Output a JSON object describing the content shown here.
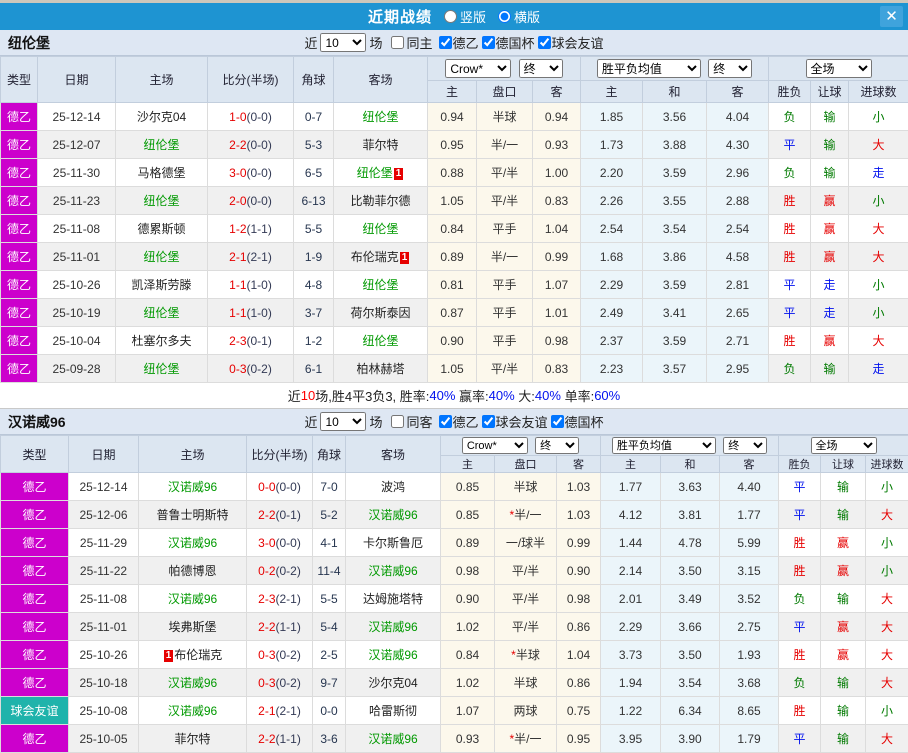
{
  "titlebar": {
    "title": "近期战绩",
    "radios": [
      {
        "label": "竖版",
        "checked": false
      },
      {
        "label": "横版",
        "checked": true
      }
    ],
    "close_glyph": "✕"
  },
  "colors": {
    "titlebar_blue": "#1e94d2",
    "league2_magenta": "#cc00cc",
    "friendly_teal": "#1fb3ab",
    "team_highlight_green": "#009900",
    "score_red": "#e60000",
    "result_red": "#e60000",
    "result_blue": "#0011ee",
    "result_green": "#007a00",
    "odds_col_bg": "#fcf8ec",
    "mean_col_bg": "#ebf5fa",
    "header_bg": "#dce6f1"
  },
  "columns": {
    "type": "类型",
    "date": "日期",
    "home": "主场",
    "score": "比分(半场)",
    "corner": "角球",
    "away": "客场",
    "selects": {
      "company": "Crow*",
      "final1": "终",
      "mean": "胜平负均值",
      "final2": "终",
      "scope": "全场"
    },
    "sub": [
      "主",
      "盘口",
      "客",
      "主",
      "和",
      "客",
      "胜负",
      "让球",
      "进球数"
    ]
  },
  "sections": [
    {
      "team": "纽伦堡",
      "filter": {
        "near": "近",
        "count": "10",
        "games": "场",
        "same": {
          "label": "同主",
          "checked": false
        },
        "leagues": [
          {
            "label": "德乙",
            "checked": true
          },
          {
            "label": "德国杯",
            "checked": true
          },
          {
            "label": "球会友谊",
            "checked": true
          }
        ]
      },
      "rows": [
        {
          "league": "德乙",
          "league_color": "#cc00cc",
          "date": "25-12-14",
          "home": {
            "name": "沙尔克04"
          },
          "score": "1-0",
          "half": "(0-0)",
          "corner": "0-7",
          "away": {
            "name": "纽伦堡",
            "hl": true
          },
          "odds": {
            "home": "0.94",
            "hc": "半球",
            "star": false,
            "away": "0.94"
          },
          "mean": [
            "1.85",
            "3.56",
            "4.04"
          ],
          "results": [
            {
              "t": "负",
              "c": "g"
            },
            {
              "t": "输",
              "c": "g"
            },
            {
              "t": "小",
              "c": "g"
            }
          ]
        },
        {
          "league": "德乙",
          "league_color": "#cc00cc",
          "date": "25-12-07",
          "home": {
            "name": "纽伦堡",
            "hl": true
          },
          "score": "2-2",
          "half": "(0-0)",
          "corner": "5-3",
          "away": {
            "name": "菲尔特"
          },
          "odds": {
            "home": "0.95",
            "hc": "半/一",
            "star": false,
            "away": "0.93"
          },
          "mean": [
            "1.73",
            "3.88",
            "4.30"
          ],
          "results": [
            {
              "t": "平",
              "c": "b"
            },
            {
              "t": "输",
              "c": "g"
            },
            {
              "t": "大",
              "c": "r"
            }
          ]
        },
        {
          "league": "德乙",
          "league_color": "#cc00cc",
          "date": "25-11-30",
          "home": {
            "name": "马格德堡"
          },
          "score": "3-0",
          "half": "(0-0)",
          "corner": "6-5",
          "away": {
            "name": "纽伦堡",
            "hl": true,
            "badge": "1",
            "badge_pos": "after"
          },
          "odds": {
            "home": "0.88",
            "hc": "平/半",
            "star": false,
            "away": "1.00"
          },
          "mean": [
            "2.20",
            "3.59",
            "2.96"
          ],
          "results": [
            {
              "t": "负",
              "c": "g"
            },
            {
              "t": "输",
              "c": "g"
            },
            {
              "t": "走",
              "c": "b"
            }
          ]
        },
        {
          "league": "德乙",
          "league_color": "#cc00cc",
          "date": "25-11-23",
          "home": {
            "name": "纽伦堡",
            "hl": true
          },
          "score": "2-0",
          "half": "(0-0)",
          "corner": "6-13",
          "away": {
            "name": "比勒菲尔德"
          },
          "odds": {
            "home": "1.05",
            "hc": "平/半",
            "star": false,
            "away": "0.83"
          },
          "mean": [
            "2.26",
            "3.55",
            "2.88"
          ],
          "results": [
            {
              "t": "胜",
              "c": "r"
            },
            {
              "t": "赢",
              "c": "r"
            },
            {
              "t": "小",
              "c": "g"
            }
          ]
        },
        {
          "league": "德乙",
          "league_color": "#cc00cc",
          "date": "25-11-08",
          "home": {
            "name": "德累斯顿"
          },
          "score": "1-2",
          "half": "(1-1)",
          "corner": "5-5",
          "away": {
            "name": "纽伦堡",
            "hl": true
          },
          "odds": {
            "home": "0.84",
            "hc": "平手",
            "star": false,
            "away": "1.04"
          },
          "mean": [
            "2.54",
            "3.54",
            "2.54"
          ],
          "results": [
            {
              "t": "胜",
              "c": "r"
            },
            {
              "t": "赢",
              "c": "r"
            },
            {
              "t": "大",
              "c": "r"
            }
          ]
        },
        {
          "league": "德乙",
          "league_color": "#cc00cc",
          "date": "25-11-01",
          "home": {
            "name": "纽伦堡",
            "hl": true
          },
          "score": "2-1",
          "half": "(2-1)",
          "corner": "1-9",
          "away": {
            "name": "布伦瑞克",
            "badge": "1",
            "badge_pos": "after"
          },
          "odds": {
            "home": "0.89",
            "hc": "半/一",
            "star": false,
            "away": "0.99"
          },
          "mean": [
            "1.68",
            "3.86",
            "4.58"
          ],
          "results": [
            {
              "t": "胜",
              "c": "r"
            },
            {
              "t": "赢",
              "c": "r"
            },
            {
              "t": "大",
              "c": "r"
            }
          ]
        },
        {
          "league": "德乙",
          "league_color": "#cc00cc",
          "date": "25-10-26",
          "home": {
            "name": "凯泽斯劳滕"
          },
          "score": "1-1",
          "half": "(1-0)",
          "corner": "4-8",
          "away": {
            "name": "纽伦堡",
            "hl": true
          },
          "odds": {
            "home": "0.81",
            "hc": "平手",
            "star": false,
            "away": "1.07"
          },
          "mean": [
            "2.29",
            "3.59",
            "2.81"
          ],
          "results": [
            {
              "t": "平",
              "c": "b"
            },
            {
              "t": "走",
              "c": "b"
            },
            {
              "t": "小",
              "c": "g"
            }
          ]
        },
        {
          "league": "德乙",
          "league_color": "#cc00cc",
          "date": "25-10-19",
          "home": {
            "name": "纽伦堡",
            "hl": true
          },
          "score": "1-1",
          "half": "(1-0)",
          "corner": "3-7",
          "away": {
            "name": "荷尔斯泰因"
          },
          "odds": {
            "home": "0.87",
            "hc": "平手",
            "star": false,
            "away": "1.01"
          },
          "mean": [
            "2.49",
            "3.41",
            "2.65"
          ],
          "results": [
            {
              "t": "平",
              "c": "b"
            },
            {
              "t": "走",
              "c": "b"
            },
            {
              "t": "小",
              "c": "g"
            }
          ]
        },
        {
          "league": "德乙",
          "league_color": "#cc00cc",
          "date": "25-10-04",
          "home": {
            "name": "杜塞尔多夫"
          },
          "score": "2-3",
          "half": "(0-1)",
          "corner": "1-2",
          "away": {
            "name": "纽伦堡",
            "hl": true
          },
          "odds": {
            "home": "0.90",
            "hc": "平手",
            "star": false,
            "away": "0.98"
          },
          "mean": [
            "2.37",
            "3.59",
            "2.71"
          ],
          "results": [
            {
              "t": "胜",
              "c": "r"
            },
            {
              "t": "赢",
              "c": "r"
            },
            {
              "t": "大",
              "c": "r"
            }
          ]
        },
        {
          "league": "德乙",
          "league_color": "#cc00cc",
          "date": "25-09-28",
          "home": {
            "name": "纽伦堡",
            "hl": true
          },
          "score": "0-3",
          "half": "(0-2)",
          "corner": "6-1",
          "away": {
            "name": "柏林赫塔"
          },
          "odds": {
            "home": "1.05",
            "hc": "平/半",
            "star": false,
            "away": "0.83"
          },
          "mean": [
            "2.23",
            "3.57",
            "2.95"
          ],
          "results": [
            {
              "t": "负",
              "c": "g"
            },
            {
              "t": "输",
              "c": "g"
            },
            {
              "t": "走",
              "c": "b"
            }
          ]
        }
      ],
      "summary": [
        {
          "t": "近",
          "c": "k"
        },
        {
          "t": "10",
          "c": "r"
        },
        {
          "t": "场,胜4平3负3, 胜率:",
          "c": "k"
        },
        {
          "t": "40%",
          "c": "b"
        },
        {
          "t": " 赢率:",
          "c": "k"
        },
        {
          "t": "40%",
          "c": "b"
        },
        {
          "t": " 大:",
          "c": "k"
        },
        {
          "t": "40%",
          "c": "b"
        },
        {
          "t": " 单率:",
          "c": "k"
        },
        {
          "t": "60%",
          "c": "b"
        }
      ]
    },
    {
      "team": "汉诺威96",
      "filter": {
        "near": "近",
        "count": "10",
        "games": "场",
        "same": {
          "label": "同客",
          "checked": false
        },
        "leagues": [
          {
            "label": "德乙",
            "checked": true
          },
          {
            "label": "球会友谊",
            "checked": true
          },
          {
            "label": "德国杯",
            "checked": true
          }
        ]
      },
      "rows": [
        {
          "league": "德乙",
          "league_color": "#cc00cc",
          "date": "25-12-14",
          "home": {
            "name": "汉诺威96",
            "hl": true
          },
          "score": "0-0",
          "half": "(0-0)",
          "corner": "7-0",
          "away": {
            "name": "波鸿"
          },
          "odds": {
            "home": "0.85",
            "hc": "半球",
            "star": false,
            "away": "1.03"
          },
          "mean": [
            "1.77",
            "3.63",
            "4.40"
          ],
          "results": [
            {
              "t": "平",
              "c": "b"
            },
            {
              "t": "输",
              "c": "g"
            },
            {
              "t": "小",
              "c": "g"
            }
          ]
        },
        {
          "league": "德乙",
          "league_color": "#cc00cc",
          "date": "25-12-06",
          "home": {
            "name": "普鲁士明斯特"
          },
          "score": "2-2",
          "half": "(0-1)",
          "corner": "5-2",
          "away": {
            "name": "汉诺威96",
            "hl": true
          },
          "odds": {
            "home": "0.85",
            "hc": "半/一",
            "star": true,
            "away": "1.03"
          },
          "mean": [
            "4.12",
            "3.81",
            "1.77"
          ],
          "results": [
            {
              "t": "平",
              "c": "b"
            },
            {
              "t": "输",
              "c": "g"
            },
            {
              "t": "大",
              "c": "r"
            }
          ]
        },
        {
          "league": "德乙",
          "league_color": "#cc00cc",
          "date": "25-11-29",
          "home": {
            "name": "汉诺威96",
            "hl": true
          },
          "score": "3-0",
          "half": "(0-0)",
          "corner": "4-1",
          "away": {
            "name": "卡尔斯鲁厄"
          },
          "odds": {
            "home": "0.89",
            "hc": "一/球半",
            "star": false,
            "away": "0.99"
          },
          "mean": [
            "1.44",
            "4.78",
            "5.99"
          ],
          "results": [
            {
              "t": "胜",
              "c": "r"
            },
            {
              "t": "赢",
              "c": "r"
            },
            {
              "t": "小",
              "c": "g"
            }
          ]
        },
        {
          "league": "德乙",
          "league_color": "#cc00cc",
          "date": "25-11-22",
          "home": {
            "name": "帕德博恩"
          },
          "score": "0-2",
          "half": "(0-2)",
          "corner": "11-4",
          "away": {
            "name": "汉诺威96",
            "hl": true
          },
          "odds": {
            "home": "0.98",
            "hc": "平/半",
            "star": false,
            "away": "0.90"
          },
          "mean": [
            "2.14",
            "3.50",
            "3.15"
          ],
          "results": [
            {
              "t": "胜",
              "c": "r"
            },
            {
              "t": "赢",
              "c": "r"
            },
            {
              "t": "小",
              "c": "g"
            }
          ]
        },
        {
          "league": "德乙",
          "league_color": "#cc00cc",
          "date": "25-11-08",
          "home": {
            "name": "汉诺威96",
            "hl": true
          },
          "score": "2-3",
          "half": "(2-1)",
          "corner": "5-5",
          "away": {
            "name": "达姆施塔特"
          },
          "odds": {
            "home": "0.90",
            "hc": "平/半",
            "star": false,
            "away": "0.98"
          },
          "mean": [
            "2.01",
            "3.49",
            "3.52"
          ],
          "results": [
            {
              "t": "负",
              "c": "g"
            },
            {
              "t": "输",
              "c": "g"
            },
            {
              "t": "大",
              "c": "r"
            }
          ]
        },
        {
          "league": "德乙",
          "league_color": "#cc00cc",
          "date": "25-11-01",
          "home": {
            "name": "埃弗斯堡"
          },
          "score": "2-2",
          "half": "(1-1)",
          "corner": "5-4",
          "away": {
            "name": "汉诺威96",
            "hl": true
          },
          "odds": {
            "home": "1.02",
            "hc": "平/半",
            "star": false,
            "away": "0.86"
          },
          "mean": [
            "2.29",
            "3.66",
            "2.75"
          ],
          "results": [
            {
              "t": "平",
              "c": "b"
            },
            {
              "t": "赢",
              "c": "r"
            },
            {
              "t": "大",
              "c": "r"
            }
          ]
        },
        {
          "league": "德乙",
          "league_color": "#cc00cc",
          "date": "25-10-26",
          "home": {
            "name": "布伦瑞克",
            "badge": "1",
            "badge_pos": "before"
          },
          "score": "0-3",
          "half": "(0-2)",
          "corner": "2-5",
          "away": {
            "name": "汉诺威96",
            "hl": true
          },
          "odds": {
            "home": "0.84",
            "hc": "半球",
            "star": true,
            "away": "1.04"
          },
          "mean": [
            "3.73",
            "3.50",
            "1.93"
          ],
          "results": [
            {
              "t": "胜",
              "c": "r"
            },
            {
              "t": "赢",
              "c": "r"
            },
            {
              "t": "大",
              "c": "r"
            }
          ]
        },
        {
          "league": "德乙",
          "league_color": "#cc00cc",
          "date": "25-10-18",
          "home": {
            "name": "汉诺威96",
            "hl": true
          },
          "score": "0-3",
          "half": "(0-2)",
          "corner": "9-7",
          "away": {
            "name": "沙尔克04"
          },
          "odds": {
            "home": "1.02",
            "hc": "半球",
            "star": false,
            "away": "0.86"
          },
          "mean": [
            "1.94",
            "3.54",
            "3.68"
          ],
          "results": [
            {
              "t": "负",
              "c": "g"
            },
            {
              "t": "输",
              "c": "g"
            },
            {
              "t": "大",
              "c": "r"
            }
          ]
        },
        {
          "league": "球会友谊",
          "league_color": "#1fb3ab",
          "date": "25-10-08",
          "home": {
            "name": "汉诺威96",
            "hl": true
          },
          "score": "2-1",
          "half": "(2-1)",
          "corner": "0-0",
          "away": {
            "name": "哈雷斯彻"
          },
          "odds": {
            "home": "1.07",
            "hc": "两球",
            "star": false,
            "away": "0.75"
          },
          "mean": [
            "1.22",
            "6.34",
            "8.65"
          ],
          "results": [
            {
              "t": "胜",
              "c": "r"
            },
            {
              "t": "输",
              "c": "g"
            },
            {
              "t": "小",
              "c": "g"
            }
          ]
        },
        {
          "league": "德乙",
          "league_color": "#cc00cc",
          "date": "25-10-05",
          "home": {
            "name": "菲尔特"
          },
          "score": "2-2",
          "half": "(1-1)",
          "corner": "3-6",
          "away": {
            "name": "汉诺威96",
            "hl": true
          },
          "odds": {
            "home": "0.93",
            "hc": "半/一",
            "star": true,
            "away": "0.95"
          },
          "mean": [
            "3.95",
            "3.90",
            "1.79"
          ],
          "results": [
            {
              "t": "平",
              "c": "b"
            },
            {
              "t": "输",
              "c": "g"
            },
            {
              "t": "大",
              "c": "r"
            }
          ]
        }
      ],
      "summary": null
    }
  ]
}
